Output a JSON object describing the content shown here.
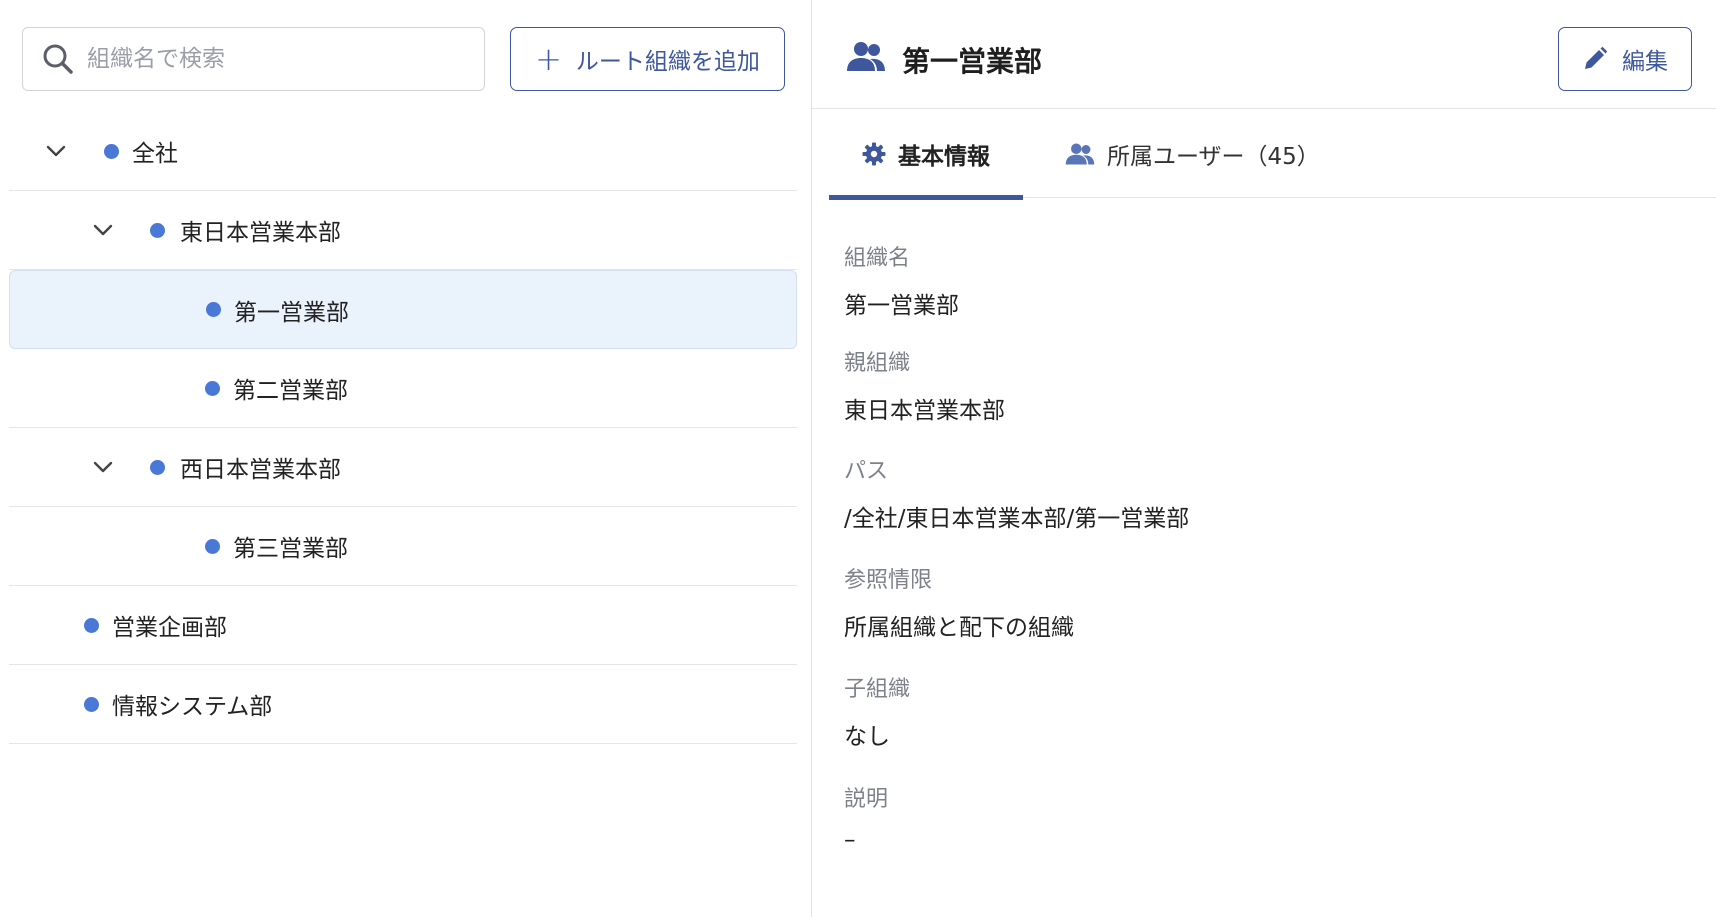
{
  "search": {
    "placeholder": "組織名で検索"
  },
  "toolbar": {
    "add_root_label": "ルート組織を追加"
  },
  "tree": {
    "nodes": [
      {
        "label": "全社"
      },
      {
        "label": "東日本営業本部"
      },
      {
        "label": "第一営業部"
      },
      {
        "label": "第二営業部"
      },
      {
        "label": "西日本営業本部"
      },
      {
        "label": "第三営業部"
      },
      {
        "label": "営業企画部"
      },
      {
        "label": "情報システム部"
      }
    ]
  },
  "detail": {
    "title": "第一営業部",
    "edit_label": "編集",
    "tabs": [
      {
        "label": "基本情報"
      },
      {
        "label": "所属ユーザー（45）"
      }
    ],
    "fields": [
      {
        "label": "組織名",
        "value": "第一営業部"
      },
      {
        "label": "親組織",
        "value": "東日本営業本部"
      },
      {
        "label": "パス",
        "value": "/全社/東日本営業本部/第一営業部"
      },
      {
        "label": "参照情限",
        "value": "所属組織と配下の組織"
      },
      {
        "label": "子組織",
        "value": "なし"
      },
      {
        "label": "説明",
        "value": "–"
      }
    ]
  },
  "colors": {
    "accent": "#3f579c",
    "dot": "#4a78d6",
    "selected_row": "#eaf2fc"
  }
}
